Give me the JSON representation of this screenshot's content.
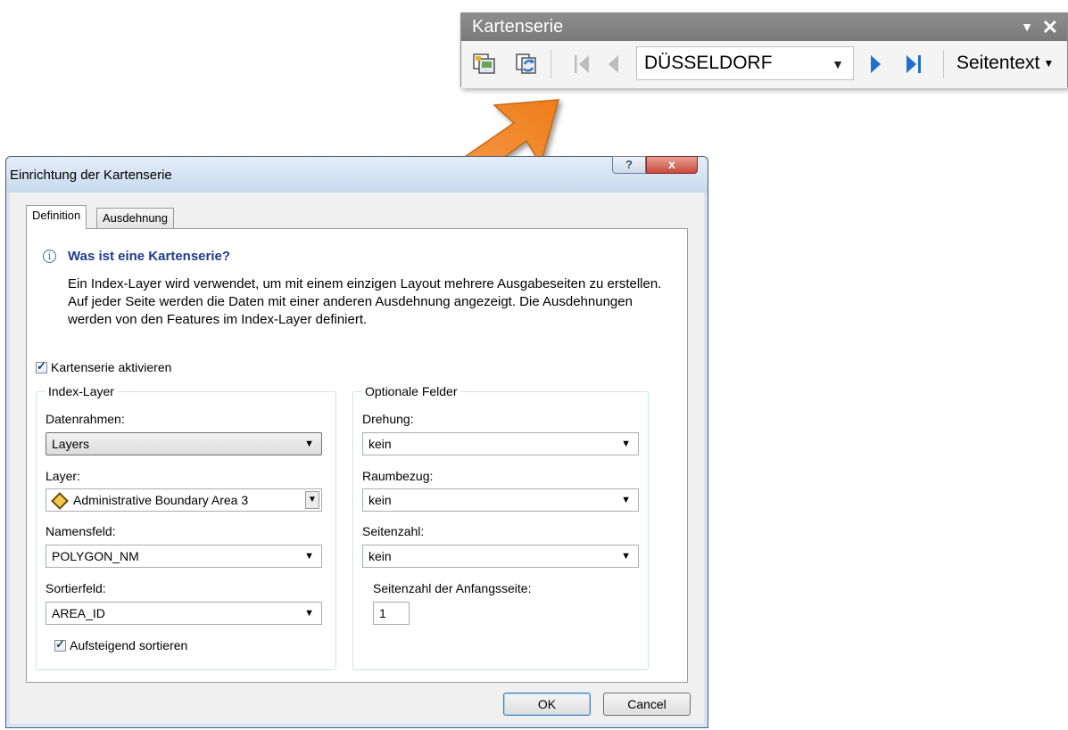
{
  "toolbar": {
    "title": "Kartenserie",
    "page_name": "DÜSSELDORF",
    "page_text_label": "Seitentext",
    "icons": [
      "data-driven-pages-setup-icon",
      "refresh-icon",
      "first-page-icon",
      "previous-page-icon",
      "next-page-icon",
      "last-page-icon"
    ]
  },
  "dialog": {
    "title": "Einrichtung der Kartenserie",
    "help_label": "?",
    "close_label": "x",
    "tabs": [
      {
        "label": "Definition",
        "active": true
      },
      {
        "label": "Ausdehnung",
        "active": false
      }
    ],
    "info": {
      "title": "Was ist eine Kartenserie?",
      "text": "Ein Index-Layer wird verwendet, um mit einem einzigen Layout mehrere Ausgabeseiten zu erstellen. Auf jeder Seite werden die Daten mit einer anderen Ausdehnung angezeigt. Die Ausdehnungen werden von den Features im Index-Layer definiert."
    },
    "enable_checkbox": {
      "label": "Kartenserie aktivieren",
      "checked": true
    },
    "index_layer": {
      "title": "Index-Layer",
      "datenrahmen": {
        "label": "Datenrahmen:",
        "value": "Layers"
      },
      "layer": {
        "label": "Layer:",
        "value": "Administrative Boundary Area 3"
      },
      "namensfeld": {
        "label": "Namensfeld:",
        "value": "POLYGON_NM"
      },
      "sortierfeld": {
        "label": "Sortierfeld:",
        "value": "AREA_ID"
      },
      "sort_ascending": {
        "label": "Aufsteigend sortieren",
        "checked": true
      }
    },
    "optional_fields": {
      "title": "Optionale Felder",
      "drehung": {
        "label": "Drehung:",
        "value": "kein"
      },
      "raumbezug": {
        "label": "Raumbezug:",
        "value": "kein"
      },
      "seitenzahl": {
        "label": "Seitenzahl:",
        "value": "kein"
      },
      "start_page": {
        "label": "Seitenzahl der Anfangsseite:",
        "value": "1"
      }
    },
    "ok_label": "OK",
    "cancel_label": "Cancel"
  },
  "colors": {
    "arrow_orange": "#f28c28",
    "dialog_frame": "#d5e3f2",
    "info_title": "#1e3c8c",
    "nav_active": "#1f6fd0"
  }
}
